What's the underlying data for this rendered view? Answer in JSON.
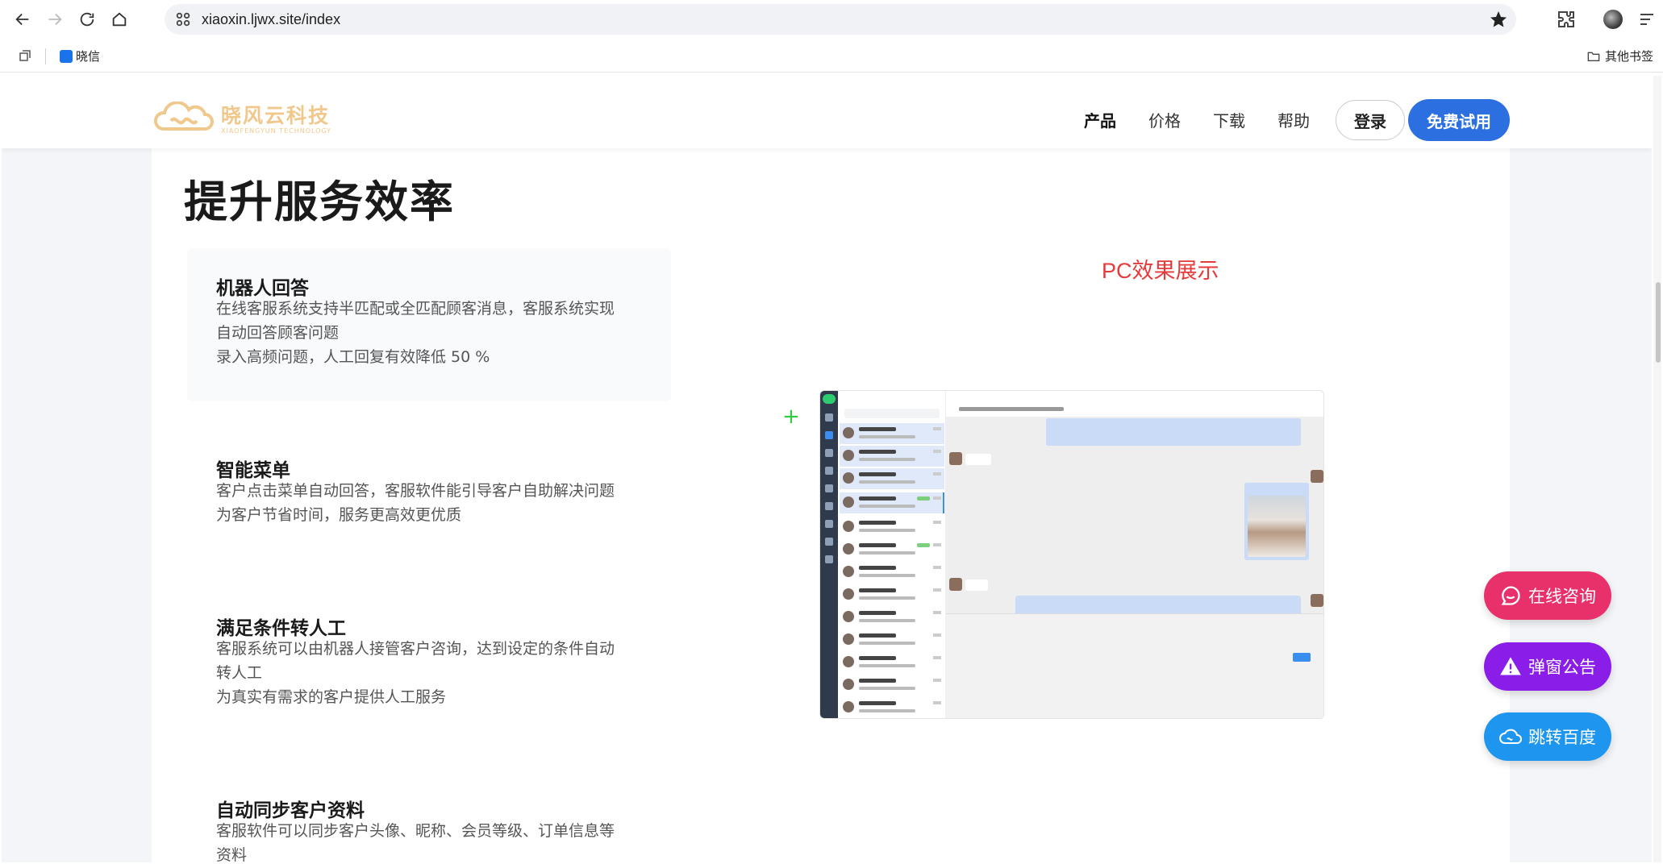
{
  "browser": {
    "url": "xiaoxin.ljwx.site/index",
    "bookmark_item": "晓信",
    "other_bookmarks": "其他书签"
  },
  "header": {
    "logo_cn": "晓风云科技",
    "logo_en": "XIAOFENGYUN TECHNOLOGY",
    "nav": [
      "产品",
      "价格",
      "下载",
      "帮助"
    ],
    "login": "登录",
    "trial": "免费试用"
  },
  "section": {
    "title": "提升服务效率",
    "pc_title": "PC效果展示"
  },
  "features": [
    {
      "title": "机器人回答",
      "lines": [
        "在线客服系统支持半匹配或全匹配顾客消息，客服系统实现",
        "自动回答顾客问题",
        "录入高频问题，人工回复有效降低 50 %"
      ]
    },
    {
      "title": "智能菜单",
      "lines": [
        "客户点击菜单自动回答，客服软件能引导客户自助解决问题",
        "为客户节省时间，服务更高效更优质"
      ]
    },
    {
      "title": "满足条件转人工",
      "lines": [
        "客服系统可以由机器人接管客户咨询，达到设定的条件自动",
        "转人工",
        "为真实有需求的客户提供人工服务"
      ]
    },
    {
      "title": "自动同步客户资料",
      "lines": [
        "客服软件可以同步客户头像、昵称、会员等级、订单信息等",
        "资料"
      ]
    }
  ],
  "floating": {
    "consult": "在线咨询",
    "notice": "弹窗公告",
    "baidu": "跳转百度"
  },
  "colors": {
    "trial_blue": "#2b6fe0",
    "pc_title_red": "#e53a3a",
    "consult_pink": "#e8316a",
    "notice_purple": "#8b1de8",
    "baidu_blue": "#1e96f0"
  }
}
